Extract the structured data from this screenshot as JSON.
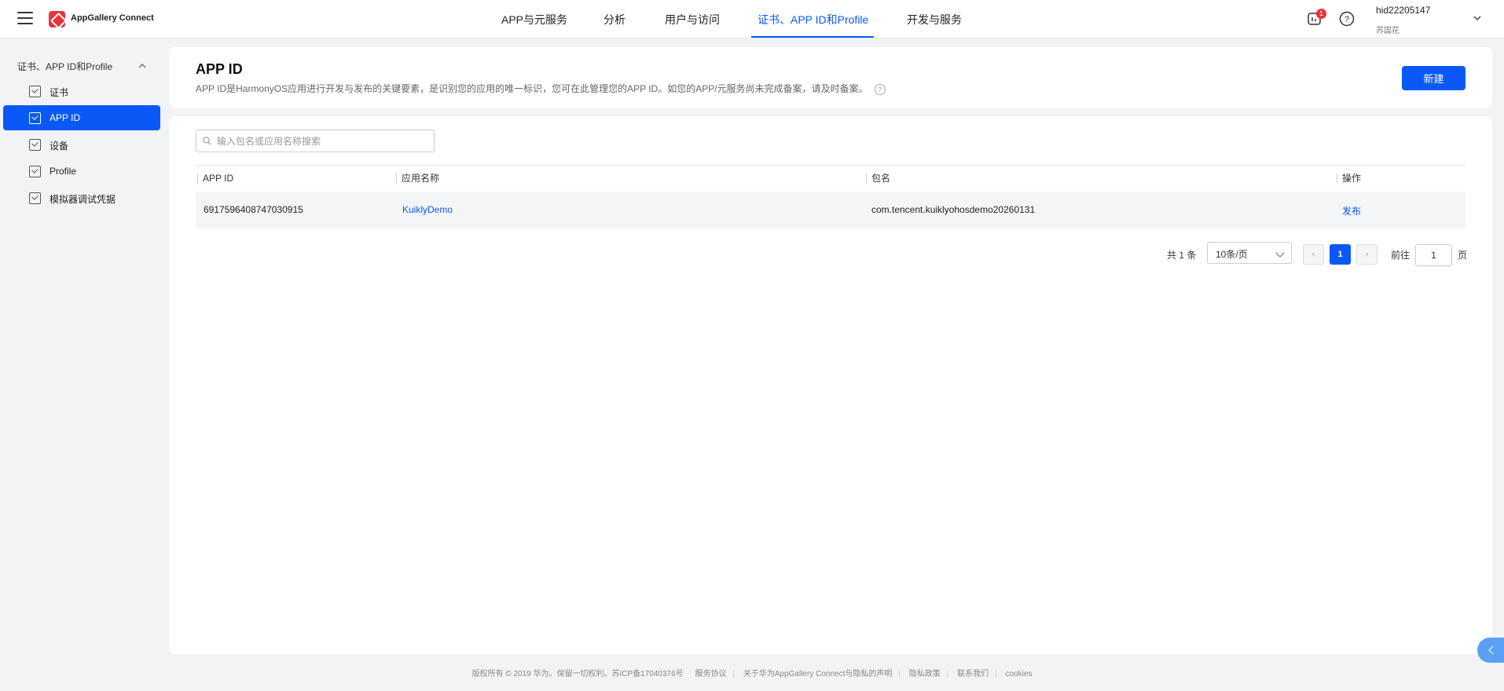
{
  "topbar": {
    "brand": "AppGallery Connect",
    "nav": [
      {
        "label": "APP与元服务"
      },
      {
        "label": "分析"
      },
      {
        "label": "用户与访问"
      },
      {
        "label": "证书、APP ID和Profile",
        "active": true
      },
      {
        "label": "开发与服务"
      }
    ],
    "notification_count": "1",
    "user_name": "hid22205147",
    "user_sub": "苏国花"
  },
  "sidebar": {
    "group_label": "证书、APP ID和Profile",
    "items": [
      {
        "label": "证书"
      },
      {
        "label": "APP ID",
        "active": true
      },
      {
        "label": "设备"
      },
      {
        "label": "Profile"
      },
      {
        "label": "模拟器调试凭据"
      }
    ]
  },
  "header": {
    "title": "APP ID",
    "description": "APP ID是HarmonyOS应用进行开发与发布的关键要素，是识别您的应用的唯一标识，您可在此管理您的APP ID。如您的APP/元服务尚未完成备案，请及时备案。",
    "help_glyph": "?",
    "new_button": "新建"
  },
  "search": {
    "placeholder": "输入包名或应用名称搜索",
    "value": ""
  },
  "table": {
    "columns": [
      "APP ID",
      "应用名称",
      "包名",
      "操作"
    ],
    "rows": [
      {
        "app_id": "6917596408747030915",
        "app_name": "KuiklyDemo",
        "package": "com.tencent.kuiklyohosdemo20260131",
        "action": "发布"
      }
    ]
  },
  "pagination": {
    "total_label": "共 1 条",
    "page_size": "10条/页",
    "prev": "‹",
    "current_page": "1",
    "next": "›",
    "goto_label": "前往",
    "goto_value": "1",
    "goto_suffix": "页"
  },
  "footer": {
    "copyright": "版权所有 © 2019 华为。保留一切权利。苏ICP备17040376号",
    "links": [
      "服务协议",
      "关于华为AppGallery Connect与隐私的声明",
      "隐私政策",
      "联系我们",
      "cookies"
    ]
  },
  "colors": {
    "accent": "#0a59f7",
    "brand_red": "#e8333b",
    "background": "#f1f3f5"
  }
}
